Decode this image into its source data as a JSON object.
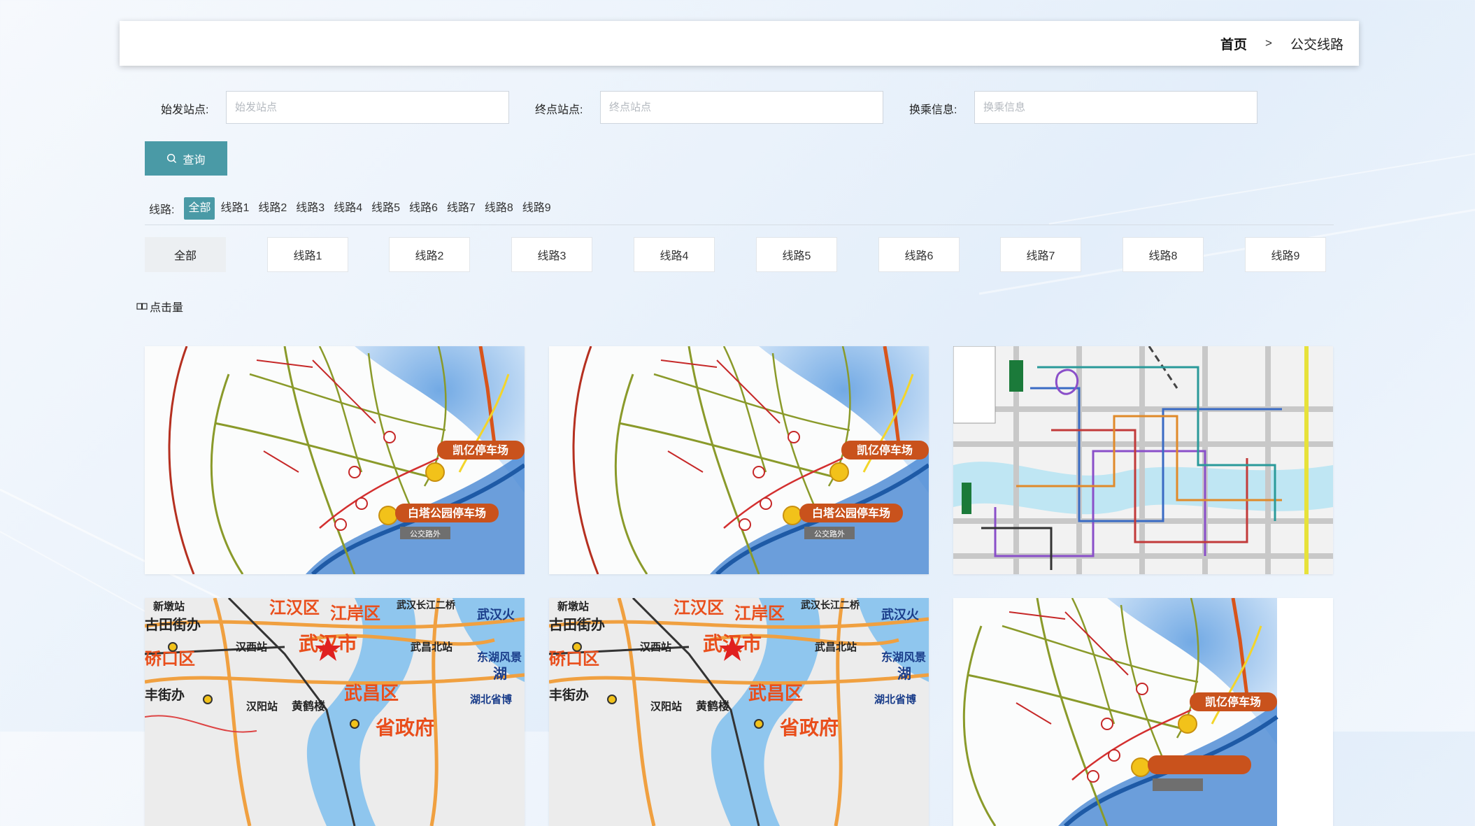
{
  "breadcrumb": {
    "home": "首页",
    "separator": ">",
    "current": "公交线路"
  },
  "search": {
    "start_label": "始发站点:",
    "start_placeholder": "始发站点",
    "start_value": "",
    "end_label": "终点站点:",
    "end_placeholder": "终点站点",
    "end_value": "",
    "transfer_label": "换乘信息:",
    "transfer_placeholder": "换乘信息",
    "transfer_value": "",
    "query_label": "查询",
    "query_icon": "search-icon"
  },
  "route_filter": {
    "label": "线路:",
    "items": [
      "全部",
      "线路1",
      "线路2",
      "线路3",
      "线路4",
      "线路5",
      "线路6",
      "线路7",
      "线路8",
      "线路9"
    ],
    "selected": "全部"
  },
  "tabs": {
    "items": [
      "全部",
      "线路1",
      "线路2",
      "线路3",
      "线路4",
      "线路5",
      "线路6",
      "线路7",
      "线路8",
      "线路9"
    ],
    "selected": "全部"
  },
  "sort": {
    "icon": "book-icon",
    "label": "点击量"
  },
  "map_labels": {
    "parking_a": "凯亿停车场",
    "parking_b": "白塔公园停车场",
    "bus_tag": "公交路外",
    "wuhan_districts": [
      "江汉区",
      "江岸区",
      "武汉市",
      "武昌区",
      "硚口区",
      "省政府"
    ],
    "wuhan_places": [
      "新墩站",
      "古田街办",
      "汉西站",
      "武汉长江二桥",
      "武汉火",
      "武昌北站",
      "东湖风景",
      "湖北省博",
      "丰街办",
      "汉阳站",
      "黄鹤楼",
      "湖"
    ]
  },
  "colors": {
    "accent": "#4a9aa6",
    "active_tab_bg": "#eceff2"
  }
}
